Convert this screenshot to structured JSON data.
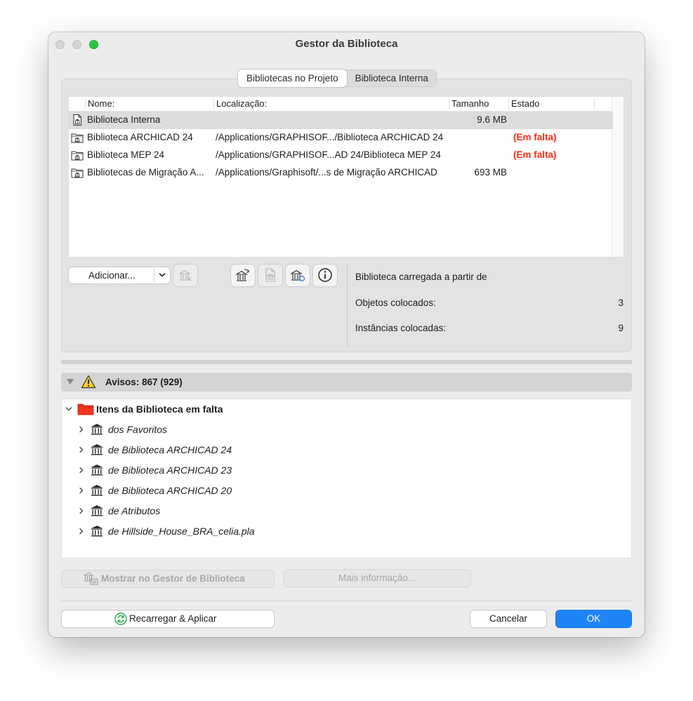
{
  "window": {
    "title": "Gestor da Biblioteca"
  },
  "tabs": [
    {
      "label": "Bibliotecas no Projeto",
      "active": true
    },
    {
      "label": "Biblioteca Interna",
      "active": false
    }
  ],
  "table": {
    "columns": [
      "Nome:",
      "Localização:",
      "Tamanho",
      "Estado"
    ],
    "rows": [
      {
        "name": "Biblioteca Interna",
        "location": "",
        "size": "9.6 MB",
        "status": "",
        "icon": "library-file-icon",
        "selected": true
      },
      {
        "name": "Biblioteca ARCHICAD 24",
        "location": "/Applications/GRAPHISOF.../Biblioteca ARCHICAD 24",
        "size": "",
        "status": "(Em falta)",
        "icon": "library-folder-icon"
      },
      {
        "name": "Biblioteca MEP 24",
        "location": "/Applications/GRAPHISOF...AD 24/Biblioteca MEP 24",
        "size": "",
        "status": "(Em falta)",
        "icon": "library-folder-icon"
      },
      {
        "name": "Bibliotecas de Migração A...",
        "location": "/Applications/Graphisoft/...s de Migração ARCHICAD",
        "size": "693 MB",
        "status": "",
        "icon": "library-folder-icon"
      }
    ]
  },
  "toolbar": {
    "add_label": "Adicionar..."
  },
  "info_panel": {
    "loaded_from_label": "Biblioteca carregada a partir de",
    "objects_label": "Objetos colocados:",
    "objects_value": "3",
    "instances_label": "Instâncias colocadas:",
    "instances_value": "9"
  },
  "warnings": {
    "label": "Avisos: 867 (929)"
  },
  "tree": {
    "root": "Itens da Biblioteca em falta",
    "children": [
      "dos Favoritos",
      "de Biblioteca ARCHICAD 24",
      "de Biblioteca ARCHICAD 23",
      "de Biblioteca ARCHICAD 20",
      "de Atributos",
      "de Hillside_House_BRA_celia.pla"
    ]
  },
  "buttons": {
    "show_in_manager": "Mostrar no Gestor de Biblioteca",
    "more_info": "Mais informação...",
    "reload_apply": "Recarregar & Aplicar",
    "cancel": "Cancelar",
    "ok": "OK"
  },
  "colors": {
    "accent": "#1f84f7",
    "missing": "#ff2a12",
    "folder": "#f2351c",
    "reload": "#2aa84a"
  }
}
